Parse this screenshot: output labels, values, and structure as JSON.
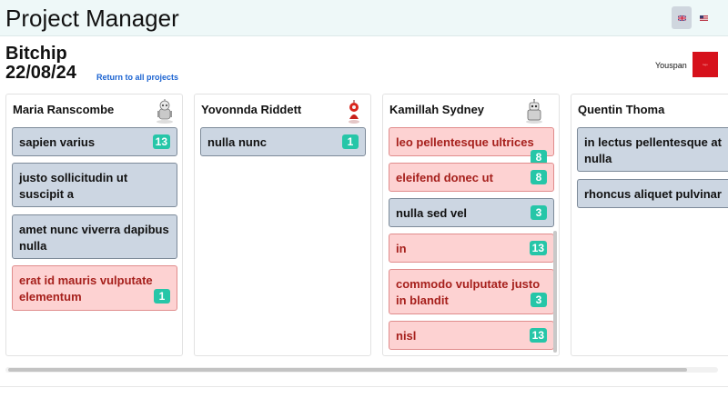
{
  "app": {
    "title": "Project Manager"
  },
  "language": {
    "options": [
      {
        "name": "English (UK)",
        "icon": "uk-flag-icon",
        "active": true
      },
      {
        "name": "English (US)",
        "icon": "us-flag-icon",
        "active": false
      }
    ]
  },
  "project": {
    "name": "Bitchip",
    "date": "22/08/24",
    "back_link": "Return to all projects",
    "company": "Youspan",
    "logo_color": "#d6111b"
  },
  "columns": [
    {
      "name": "Maria Ranscombe",
      "avatar": "robot-avatar-icon",
      "tasks": [
        {
          "title": "sapien varius",
          "count": "13",
          "status": "normal"
        },
        {
          "title": "justo sollicitudin ut suscipit a",
          "count": "",
          "status": "normal"
        },
        {
          "title": "amet nunc viverra dapibus nulla",
          "count": "",
          "status": "normal"
        },
        {
          "title": "erat id mauris vulputate elementum",
          "count": "1",
          "status": "overdue"
        }
      ]
    },
    {
      "name": "Yovonnda Riddett",
      "avatar": "red-robot-avatar-icon",
      "tasks": [
        {
          "title": "nulla nunc",
          "count": "1",
          "status": "normal"
        }
      ]
    },
    {
      "name": "Kamillah Sydney",
      "avatar": "robot-avatar-icon",
      "tasks": [
        {
          "title": "leo pellentesque ultrices",
          "count": "8",
          "status": "overdue"
        },
        {
          "title": "eleifend donec ut",
          "count": "8",
          "status": "overdue"
        },
        {
          "title": "nulla sed vel",
          "count": "3",
          "status": "normal"
        },
        {
          "title": "in",
          "count": "13",
          "status": "overdue"
        },
        {
          "title": "commodo vulputate justo in blandit",
          "count": "3",
          "status": "overdue"
        },
        {
          "title": "nisl",
          "count": "13",
          "status": "overdue"
        }
      ]
    },
    {
      "name": "Quentin Thoma",
      "avatar": "",
      "tasks": [
        {
          "title": "in lectus pellentesque at nulla",
          "count": "",
          "status": "normal"
        },
        {
          "title": "rhoncus aliquet pulvinar",
          "count": "",
          "status": "normal"
        }
      ]
    }
  ],
  "colors": {
    "card_normal": "#ccd6e2",
    "card_overdue": "#fdd2d2",
    "badge": "#26c6a8",
    "link": "#1b63d1"
  }
}
